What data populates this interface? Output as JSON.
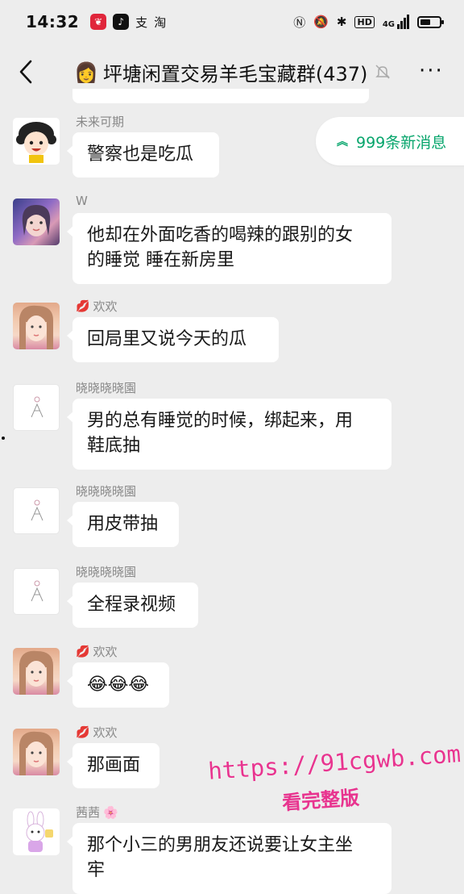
{
  "status": {
    "time": "14:32",
    "apps": [
      "app-a",
      "app-b",
      "支",
      "淘"
    ],
    "right_icons": [
      "nfc-icon",
      "mute-icon",
      "bluetooth-icon",
      "HD",
      "4G",
      "battery-icon"
    ],
    "hd": "HD",
    "net": "4G"
  },
  "nav": {
    "title_emoji": "👩",
    "title": "坪塘闲置交易羊毛宝藏群(437)",
    "more": "···"
  },
  "new_messages": {
    "label": "999条新消息",
    "accent": "#07a56c"
  },
  "messages": [
    {
      "nick": "未来可期",
      "text": "警察也是吃瓜"
    },
    {
      "nick": "W",
      "text_lines": [
        "他却在外面吃香的喝辣的跟别的女",
        "的睡觉 睡在新房里"
      ]
    },
    {
      "nick_icon": "💋",
      "nick": "欢欢",
      "text": "回局里又说今天的瓜"
    },
    {
      "nick": "晓晓晓晓園",
      "text_lines": [
        "男的总有睡觉的时候，绑起来，用",
        "鞋底抽"
      ]
    },
    {
      "nick": "晓晓晓晓園",
      "text": "用皮带抽"
    },
    {
      "nick": "晓晓晓晓園",
      "text": "全程录视频"
    },
    {
      "nick_icon": "💋",
      "nick": "欢欢",
      "text": "😂😂😂"
    },
    {
      "nick_icon": "💋",
      "nick": "欢欢",
      "text": "那画面"
    },
    {
      "nick": "茜茜",
      "nick_suffix": "🌸",
      "text_lines": [
        "那个小三的男朋友还说要让女主坐",
        "牢"
      ]
    }
  ],
  "watermark": {
    "url": "https://91cgwb.com",
    "caption": "看完整版",
    "color": "#e8348f"
  }
}
